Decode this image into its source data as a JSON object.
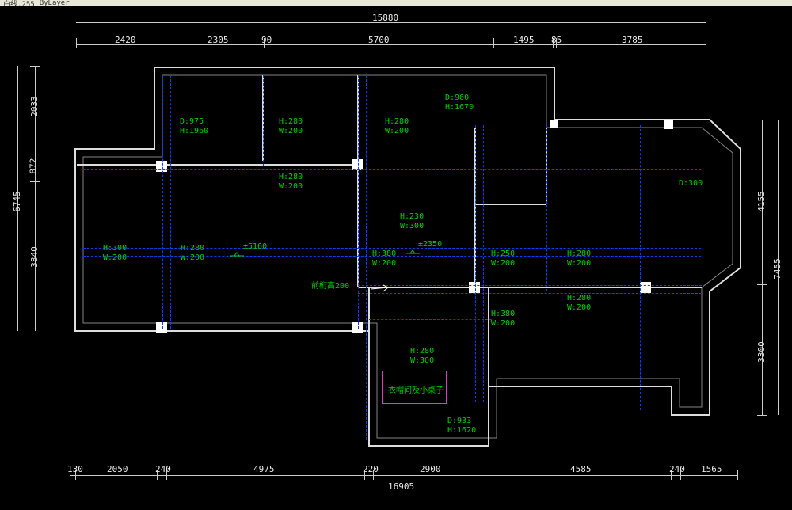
{
  "toolbar": {
    "layer_field": "ByLayer",
    "dropdown": "白线.255"
  },
  "dims": {
    "top_total": "15880",
    "top_seg": [
      "2420",
      "2305",
      "90",
      "5700",
      "1495",
      "85",
      "3785"
    ],
    "bottom_total": "16905",
    "bottom_seg": [
      "130",
      "2050",
      "240",
      "4975",
      "220",
      "2900",
      "4585",
      "240",
      "1565"
    ],
    "left_total": "6745",
    "left_seg": [
      "2033",
      "872",
      "3840"
    ],
    "right_total": "7455",
    "right_seg": [
      "4155",
      "3300"
    ]
  },
  "notes": {
    "n1": "D:975\nH:1960",
    "n2": "H:280\nW:200",
    "n3": "H:280\nW:200",
    "n4": "D:960\nH:1670",
    "n5": "H:280\nW:200",
    "n6": "H:230\nW:300",
    "n7": "H:300\nW:200",
    "n8": "H:280\nW:200",
    "n9": "H:380\nW:200",
    "n10": "H:250\nW:200",
    "n11": "H:280\nW:200",
    "n12": "D:300",
    "n13": "前桁高200",
    "n14": "H:280\nW:200",
    "n15": "H:380\nW:200",
    "n16": "H:280\nW:300",
    "n17": "D:933\nH:1620",
    "box_label": "衣帽间及小桌子",
    "lvl1": "±5160",
    "lvl2": "±2350"
  }
}
